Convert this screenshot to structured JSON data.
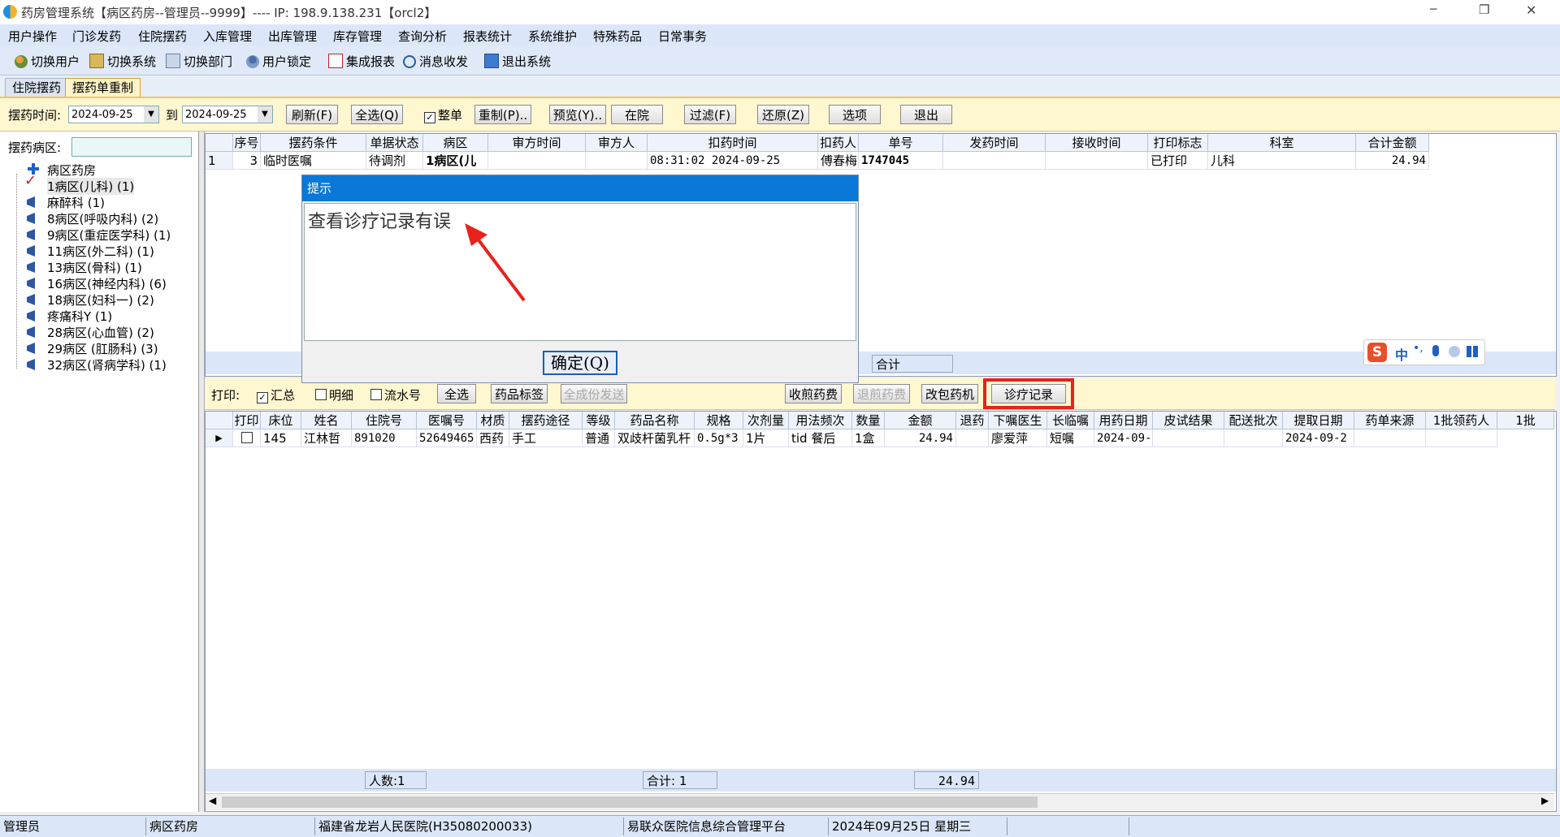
{
  "window": {
    "title": "药房管理系统【病区药房--管理员--9999】---- IP: 198.9.138.231【orcl2】",
    "buttons": {
      "minimize": "─",
      "restore": "❐",
      "close": "✕"
    }
  },
  "menu": [
    "用户操作",
    "门诊发药",
    "住院摆药",
    "入库管理",
    "出库管理",
    "库存管理",
    "查询分析",
    "报表统计",
    "系统维护",
    "特殊药品",
    "日常事务"
  ],
  "toolbar": [
    "切换用户",
    "切换系统",
    "切换部门",
    "用户锁定",
    "集成报表",
    "消息收发",
    "退出系统"
  ],
  "tabs": [
    "住院摆药",
    "摆药单重制"
  ],
  "filter": {
    "label_time": "摆药时间:",
    "date_from": "2024-09-25",
    "label_to": "到",
    "date_to": "2024-09-25",
    "btn_refresh": "刷新(F)",
    "btn_select_all": "全选(Q)",
    "chk_whole": "整单",
    "btn_remake": "重制(P)..",
    "btn_preview": "预览(Y)..",
    "btn_inhosp": "在院",
    "btn_filter": "过滤(F)",
    "btn_restore": "还原(Z)",
    "btn_options": "选项",
    "btn_exit": "退出"
  },
  "left": {
    "ward_label": "摆药病区:",
    "ward_value": "",
    "root": "病区药房",
    "items": [
      "1病区(儿科) (1)",
      "麻醉科 (1)",
      "8病区(呼吸内科) (2)",
      "9病区(重症医学科) (1)",
      "11病区(外二科) (1)",
      "13病区(骨科) (1)",
      "16病区(神经内科) (6)",
      "18病区(妇科一) (2)",
      "疼痛科Y (1)",
      "28病区(心血管) (2)",
      "29病区 (肛肠科) (3)",
      "32病区(肾病学科) (1)"
    ]
  },
  "top_grid": {
    "headers": [
      "序号",
      "摆药条件",
      "单据状态",
      "病区",
      "审方时间",
      "审方人",
      "扣药时间",
      "扣药人",
      "单号",
      "发药时间",
      "接收时间",
      "打印标志",
      "科室",
      "合计金额"
    ],
    "row": {
      "idx": "1",
      "seq": "3",
      "cond": "临时医嘱",
      "status": "待调剂",
      "ward": "1病区(儿",
      "review_time": "",
      "reviewer": "",
      "deduct_time": "08:31:02 2024-09-25",
      "deductor": "傅春梅",
      "number": "1747045",
      "dispense_time": "",
      "receive_time": "",
      "print_flag": "已打印",
      "dept": "儿科",
      "amount": "24.94"
    },
    "footer_total": "合计"
  },
  "print_bar": {
    "label": "打印:",
    "chk_summary": "汇总",
    "chk_detail": "明细",
    "chk_serial": "流水号",
    "btn_select_all": "全选",
    "btn_label": "药品标签",
    "btn_full_send": "全成份发送",
    "btn_collect": "收煎药费",
    "btn_refund": "退煎药费",
    "btn_change": "改包药机",
    "btn_records": "诊疗记录"
  },
  "bottom_grid": {
    "headers": [
      "打印",
      "床位",
      "姓名",
      "住院号",
      "医嘱号",
      "材质",
      "摆药途径",
      "等级",
      "药品名称",
      "规格",
      "次剂量",
      "用法频次",
      "数量",
      "金额",
      "退药",
      "下嘱医生",
      "长临嘱",
      "用药日期",
      "皮试结果",
      "配送批次",
      "提取日期",
      "药单来源",
      "1批领药人",
      "1批"
    ],
    "row": {
      "bed": "145",
      "name": "江林哲",
      "inpatient_no": "891020",
      "order_no": "52649465",
      "material": "西药",
      "route": "手工",
      "level": "普通",
      "drug": "双歧杆菌乳杆",
      "spec": "0.5g*3",
      "dose": "1片",
      "freq": "tid 餐后",
      "qty": "1盒",
      "amount": "24.94",
      "refund": "",
      "doctor": "廖爱萍",
      "longshort": "短嘱",
      "use_date": "2024-09-",
      "skin": "",
      "batch": "",
      "extract_date": "2024-09-2",
      "source": "",
      "receiver": ""
    },
    "footer": {
      "people": "人数:1",
      "total": "合计: 1",
      "amount": "24.94"
    }
  },
  "dialog": {
    "title": "提示",
    "message": "查看诊疗记录有误",
    "ok": "确定(Q)"
  },
  "ime": {
    "cn": "中",
    "punct": "•,"
  },
  "status": {
    "user": "管理员",
    "dept": "病区药房",
    "hospital": "福建省龙岩人民医院(H35080200033)",
    "platform": "易联众医院信息综合管理平台",
    "date": "2024年09月25日 星期三"
  },
  "colors": {
    "dialog_title": "#0a78d7",
    "highlight": "#e8221c",
    "arrow": "#e8221c"
  }
}
